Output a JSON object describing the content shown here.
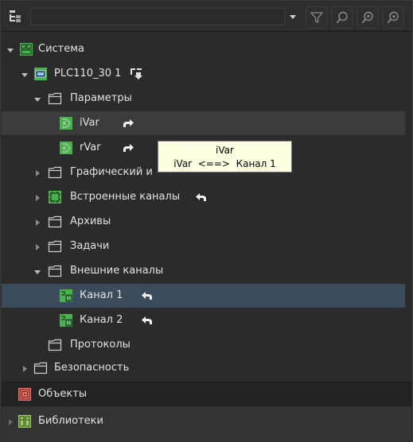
{
  "toolbar": {
    "search_value": "",
    "search_placeholder": "",
    "icons": [
      "tree-structure-icon",
      "dropdown-arrow-icon",
      "filter-icon",
      "search-icon",
      "search-next-icon",
      "search-prev-icon"
    ]
  },
  "tree": {
    "items": [
      {
        "label": "Система",
        "icon": "system-icon"
      },
      {
        "label": "PLC110_30 1",
        "icon": "plc-icon"
      },
      {
        "label": "Параметры",
        "icon": "folder-icon"
      },
      {
        "label": "iVar",
        "icon": "variable-icon"
      },
      {
        "label": "rVar",
        "icon": "variable-icon"
      },
      {
        "label": "Графический и",
        "icon": "folder-icon"
      },
      {
        "label": "Встроенные каналы",
        "icon": "channels-icon"
      },
      {
        "label": "Архивы",
        "icon": "folder-icon"
      },
      {
        "label": "Задачи",
        "icon": "folder-icon"
      },
      {
        "label": "Внешние каналы",
        "icon": "folder-icon"
      },
      {
        "label": "Канал 1",
        "icon": "channel-icon"
      },
      {
        "label": "Канал 2",
        "icon": "channel-icon"
      },
      {
        "label": "Протоколы",
        "icon": "folder-icon"
      },
      {
        "label": "Безопасность",
        "icon": "folder-icon"
      }
    ]
  },
  "tooltip": {
    "title": "iVar",
    "line": "iVar  <==>  Канал 1"
  },
  "panels": [
    {
      "label": "Объекты",
      "icon": "objects-icon"
    },
    {
      "label": "Библиотеки",
      "icon": "libraries-icon"
    }
  ],
  "colors": {
    "background": "#2b2b2b",
    "selected_row": "#3a4b5c",
    "hover_row": "#3b3b3b",
    "icon_green": "#4caf50",
    "tooltip_bg": "#ffffe1",
    "objects_icon": "#e8736a"
  }
}
